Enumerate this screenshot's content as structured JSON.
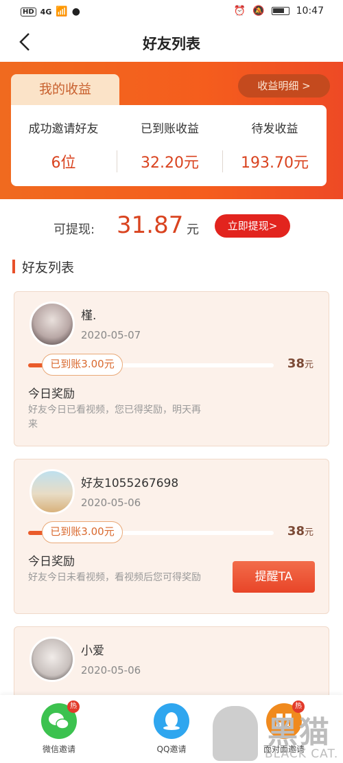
{
  "status_bar": {
    "left_hd": "HD",
    "left_signal": "4G",
    "time": "10:47"
  },
  "nav": {
    "back_glyph": "‹",
    "title": "好友列表"
  },
  "earnings": {
    "tab_label": "我的收益",
    "detail_button": "收益明细 >",
    "columns": [
      {
        "label": "成功邀请好友",
        "value": "6位"
      },
      {
        "label": "已到账收益",
        "value": "32.20元"
      },
      {
        "label": "待发收益",
        "value": "193.70元"
      }
    ]
  },
  "withdraw": {
    "label": "可提现:",
    "amount": "31.87",
    "unit": "元",
    "button": "立即提现>"
  },
  "section": {
    "title": "好友列表"
  },
  "friends": [
    {
      "name": "槿.",
      "date": "2020-05-07",
      "progress_chip": "已到账3.00元",
      "progress_fraction": 0.079,
      "total_value": "38",
      "total_unit": "元",
      "reward_title": "今日奖励",
      "reward_text": "好友今日已看视频，您已得奖励，明天再来",
      "has_remind": false
    },
    {
      "name": "好友1055267698",
      "date": "2020-05-06",
      "progress_chip": "已到账3.00元",
      "progress_fraction": 0.079,
      "total_value": "38",
      "total_unit": "元",
      "reward_title": "今日奖励",
      "reward_text": "好友今日未看视频，看视频后您可得奖励",
      "has_remind": true,
      "remind_button": "提醒TA"
    },
    {
      "name": "小爱",
      "date": "2020-05-06"
    }
  ],
  "bottom_bar": {
    "items": [
      {
        "label": "微信邀请",
        "icon": "wechat-icon",
        "color": "#3cc24f",
        "hot": "热"
      },
      {
        "label": "QQ邀请",
        "icon": "qq-icon",
        "color": "#2fa6ef"
      },
      {
        "label": "面对面邀请",
        "icon": "qrcode-icon",
        "color": "#f08a1e",
        "hot": "热"
      }
    ]
  },
  "watermark": {
    "cn": "黑猫",
    "en": "BLACK CAT."
  },
  "colors": {
    "accent": "#d9431f",
    "orange_bg": "#f06a1f",
    "card_bg": "#fcf1ea"
  }
}
